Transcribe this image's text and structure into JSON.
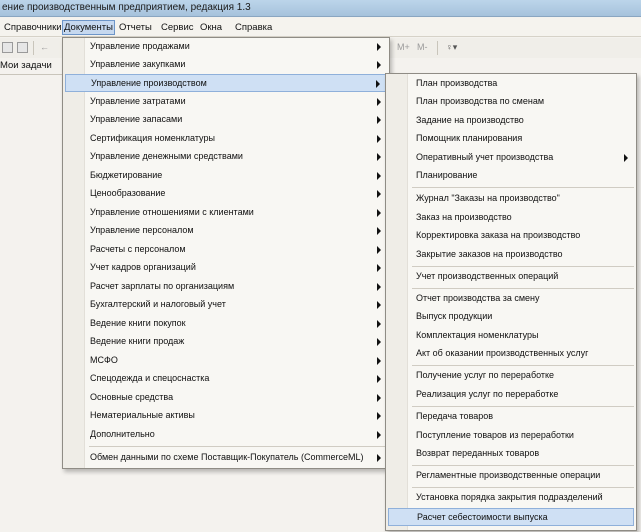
{
  "window": {
    "title": "ение производственным предприятием, редакция 1.3"
  },
  "menubar": {
    "items": [
      {
        "label": "Справочники"
      },
      {
        "label": "Документы",
        "active": true
      },
      {
        "label": "Отчеты"
      },
      {
        "label": "Сервис"
      },
      {
        "label": "Окна"
      },
      {
        "label": "Справка"
      }
    ]
  },
  "toolbar": {
    "mplus": "M+",
    "mminus": "M-"
  },
  "tasks_label": "Мои задачи",
  "documents_menu": {
    "items": [
      {
        "label": "Управление продажами",
        "submenu": true
      },
      {
        "label": "Управление закупками",
        "submenu": true
      },
      {
        "label": "Управление производством",
        "submenu": true,
        "highlighted": true
      },
      {
        "label": "Управление затратами",
        "submenu": true
      },
      {
        "label": "Управление запасами",
        "submenu": true
      },
      {
        "label": "Сертификация номенклатуры",
        "submenu": true
      },
      {
        "label": "Управление денежными средствами",
        "submenu": true
      },
      {
        "label": "Бюджетирование",
        "submenu": true
      },
      {
        "label": "Ценообразование",
        "submenu": true
      },
      {
        "label": "Управление отношениями с клиентами",
        "submenu": true
      },
      {
        "label": "Управление персоналом",
        "submenu": true
      },
      {
        "label": "Расчеты с персоналом",
        "submenu": true
      },
      {
        "label": "Учет кадров организаций",
        "submenu": true
      },
      {
        "label": "Расчет зарплаты по организациям",
        "submenu": true
      },
      {
        "label": "Бухгалтерский и налоговый учет",
        "submenu": true
      },
      {
        "label": "Ведение книги покупок",
        "submenu": true
      },
      {
        "label": "Ведение книги продаж",
        "submenu": true
      },
      {
        "label": "МСФО",
        "submenu": true
      },
      {
        "label": "Спецодежда и спецоснастка",
        "submenu": true
      },
      {
        "label": "Основные средства",
        "submenu": true
      },
      {
        "label": "Нематериальные активы",
        "submenu": true
      },
      {
        "label": "Дополнительно",
        "submenu": true
      },
      {
        "label": "Обмен данными по схеме Поставщик-Покупатель (CommerceML)",
        "submenu": true
      }
    ]
  },
  "production_submenu": {
    "items": [
      {
        "label": "План производства"
      },
      {
        "label": "План производства по сменам"
      },
      {
        "label": "Задание на производство"
      },
      {
        "label": "Помощник планирования"
      },
      {
        "label": "Оперативный учет производства",
        "submenu": true
      },
      {
        "label": "Планирование"
      },
      {
        "label": "Журнал \"Заказы на производство\""
      },
      {
        "label": "Заказ на производство"
      },
      {
        "label": "Корректировка заказа на производство"
      },
      {
        "label": "Закрытие заказов на производство"
      },
      {
        "label": "Учет производственных операций"
      },
      {
        "label": "Отчет производства за смену"
      },
      {
        "label": "Выпуск продукции"
      },
      {
        "label": "Комплектация номенклатуры"
      },
      {
        "label": "Акт об оказании производственных услуг"
      },
      {
        "label": "Получение услуг по переработке"
      },
      {
        "label": "Реализация услуг по переработке"
      },
      {
        "label": "Передача товаров"
      },
      {
        "label": "Поступление товаров из переработки"
      },
      {
        "label": "Возврат переданных товаров"
      },
      {
        "label": "Регламентные производственные операции"
      },
      {
        "label": "Установка порядка закрытия подразделений"
      },
      {
        "label": "Расчет себестоимости выпуска",
        "highlighted": true
      }
    ]
  }
}
